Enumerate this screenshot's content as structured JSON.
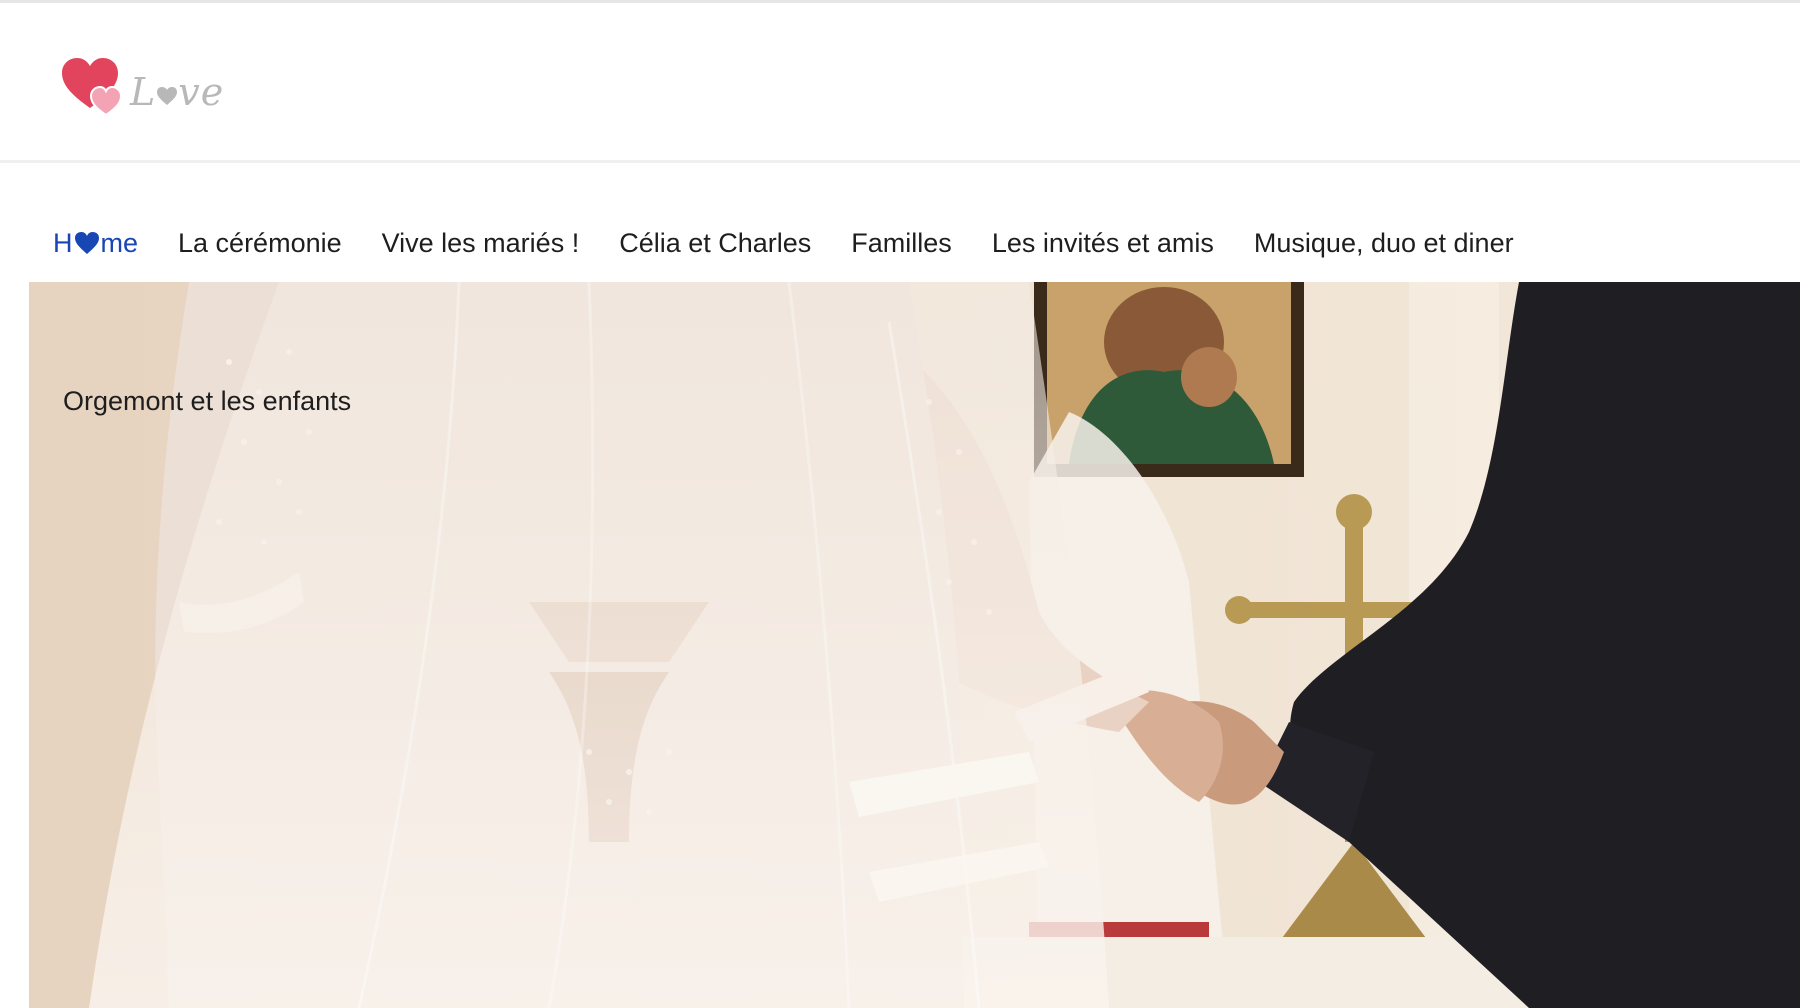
{
  "logo": {
    "word": "Lve",
    "icon": "double-heart-icon"
  },
  "nav": {
    "home": {
      "before": "H",
      "after": "me",
      "icon": "heart-icon"
    },
    "items": [
      {
        "label": "La cérémonie"
      },
      {
        "label": "Vive les mariés !"
      },
      {
        "label": "Célia et Charles"
      },
      {
        "label": "Familles"
      },
      {
        "label": "Les invités et amis"
      },
      {
        "label": "Musique, duo et diner"
      }
    ]
  },
  "hero": {
    "caption": "Orgemont et les enfants",
    "image": "wedding-ceremony-photo"
  },
  "colors": {
    "nav_active": "#1846b4",
    "nav_text": "#1e1e1e",
    "heart_red": "#e2445d",
    "heart_pink": "#f3a3b4",
    "logo_grey": "#b8b8b8"
  }
}
